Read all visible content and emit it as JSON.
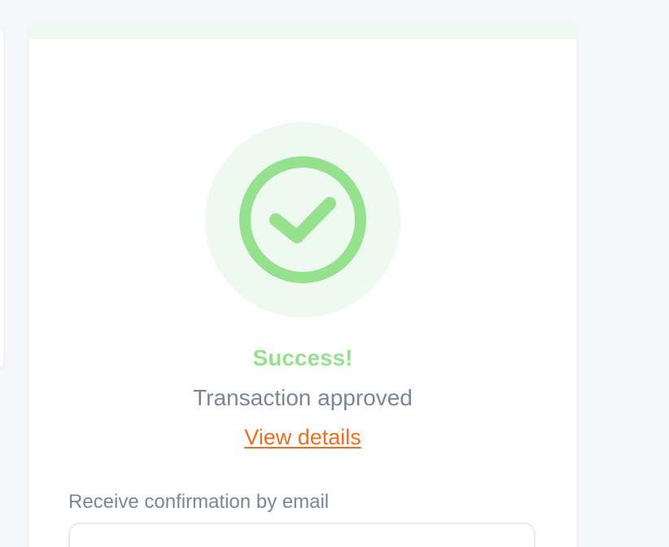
{
  "status": {
    "title": "Success!",
    "message": "Transaction approved",
    "details_link": "View details",
    "icon": "check-circle-icon"
  },
  "email": {
    "label": "Receive confirmation by email",
    "value": ""
  },
  "colors": {
    "page_background": "#f4f6fa",
    "card_background": "#ffffff",
    "success": "#95e18d",
    "success_soft": "#eef9ef",
    "muted_text": "#7a8798",
    "link": "#ef6d1f"
  }
}
